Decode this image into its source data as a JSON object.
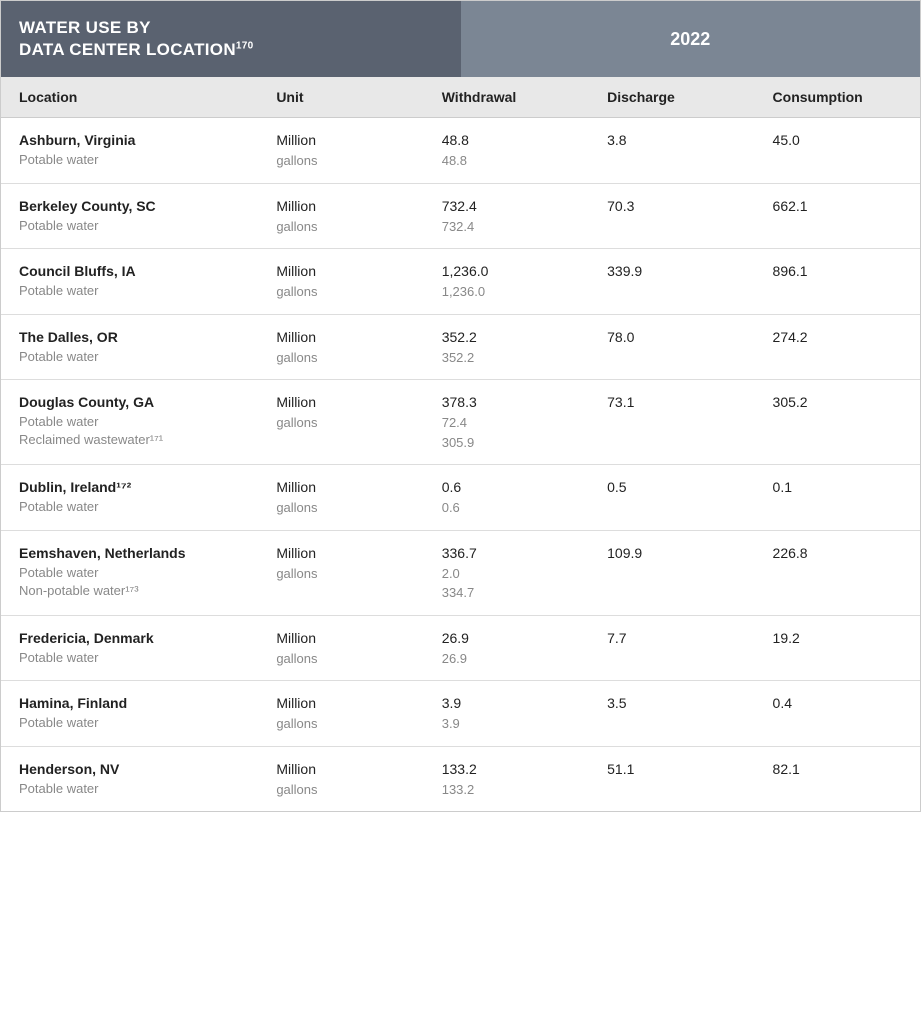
{
  "header": {
    "title": "WATER USE BY\nDATA CENTER LOCATION",
    "title_sup": "170",
    "year": "2022"
  },
  "columns": {
    "location": "Location",
    "unit": "Unit",
    "withdrawal": "Withdrawal",
    "discharge": "Discharge",
    "consumption": "Consumption"
  },
  "rows": [
    {
      "location": "Ashburn, Virginia",
      "sub_labels": [
        "Potable water"
      ],
      "unit_main": "Million",
      "unit_sub": "gallons",
      "withdrawal_main": "48.8",
      "withdrawal_subs": [
        "48.8"
      ],
      "discharge": "3.8",
      "consumption": "45.0"
    },
    {
      "location": "Berkeley County, SC",
      "sub_labels": [
        "Potable water"
      ],
      "unit_main": "Million",
      "unit_sub": "gallons",
      "withdrawal_main": "732.4",
      "withdrawal_subs": [
        "732.4"
      ],
      "discharge": "70.3",
      "consumption": "662.1"
    },
    {
      "location": "Council Bluffs, IA",
      "sub_labels": [
        "Potable water"
      ],
      "unit_main": "Million",
      "unit_sub": "gallons",
      "withdrawal_main": "1,236.0",
      "withdrawal_subs": [
        "1,236.0"
      ],
      "discharge": "339.9",
      "consumption": "896.1"
    },
    {
      "location": "The Dalles, OR",
      "sub_labels": [
        "Potable water"
      ],
      "unit_main": "Million",
      "unit_sub": "gallons",
      "withdrawal_main": "352.2",
      "withdrawal_subs": [
        "352.2"
      ],
      "discharge": "78.0",
      "consumption": "274.2"
    },
    {
      "location": "Douglas County, GA",
      "sub_labels": [
        "Potable water",
        "Reclaimed wastewater¹⁷¹"
      ],
      "unit_main": "Million",
      "unit_sub": "gallons",
      "withdrawal_main": "378.3",
      "withdrawal_subs": [
        "72.4",
        "305.9"
      ],
      "discharge": "73.1",
      "consumption": "305.2"
    },
    {
      "location": "Dublin, Ireland¹⁷²",
      "sub_labels": [
        "Potable water"
      ],
      "unit_main": "Million",
      "unit_sub": "gallons",
      "withdrawal_main": "0.6",
      "withdrawal_subs": [
        "0.6"
      ],
      "discharge": "0.5",
      "consumption": "0.1"
    },
    {
      "location": "Eemshaven, Netherlands",
      "sub_labels": [
        "Potable water",
        "Non-potable water¹⁷³"
      ],
      "unit_main": "Million",
      "unit_sub": "gallons",
      "withdrawal_main": "336.7",
      "withdrawal_subs": [
        "2.0",
        "334.7"
      ],
      "discharge": "109.9",
      "consumption": "226.8"
    },
    {
      "location": "Fredericia, Denmark",
      "sub_labels": [
        "Potable water"
      ],
      "unit_main": "Million",
      "unit_sub": "gallons",
      "withdrawal_main": "26.9",
      "withdrawal_subs": [
        "26.9"
      ],
      "discharge": "7.7",
      "consumption": "19.2"
    },
    {
      "location": "Hamina, Finland",
      "sub_labels": [
        "Potable water"
      ],
      "unit_main": "Million",
      "unit_sub": "gallons",
      "withdrawal_main": "3.9",
      "withdrawal_subs": [
        "3.9"
      ],
      "discharge": "3.5",
      "consumption": "0.4"
    },
    {
      "location": "Henderson, NV",
      "sub_labels": [
        "Potable water"
      ],
      "unit_main": "Million",
      "unit_sub": "gallons",
      "withdrawal_main": "133.2",
      "withdrawal_subs": [
        "133.2"
      ],
      "discharge": "51.1",
      "consumption": "82.1"
    }
  ]
}
